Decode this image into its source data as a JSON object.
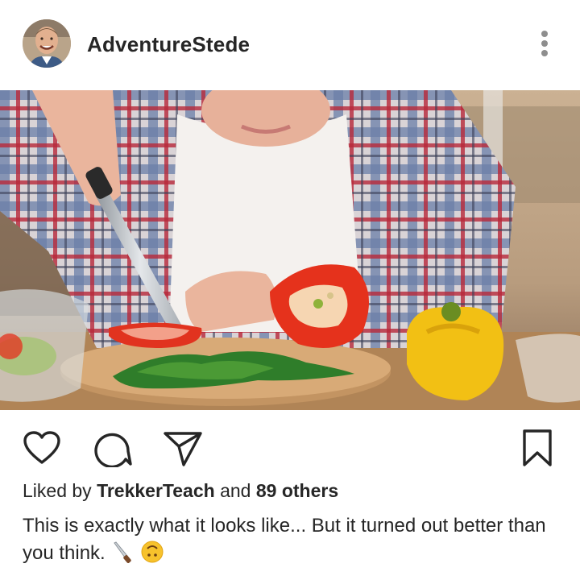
{
  "post": {
    "username": "AdventureStede",
    "liked_by_prefix": "Liked by",
    "liked_by_user": "TrekkerTeach",
    "liked_by_and": "and",
    "liked_by_others": "89 others",
    "caption": "This is exactly what it looks like... But it turned out better than you think.",
    "caption_emojis": [
      "knife-emoji",
      "upside-down-face-emoji"
    ]
  },
  "icons": {
    "more": "more-vertical-icon",
    "like": "heart-icon",
    "comment": "comment-bubble-icon",
    "share": "paper-plane-icon",
    "save": "bookmark-icon"
  },
  "colors": {
    "text": "#262626",
    "background": "#ffffff",
    "icon": "#262626",
    "more_dots": "#8e8e8e"
  }
}
